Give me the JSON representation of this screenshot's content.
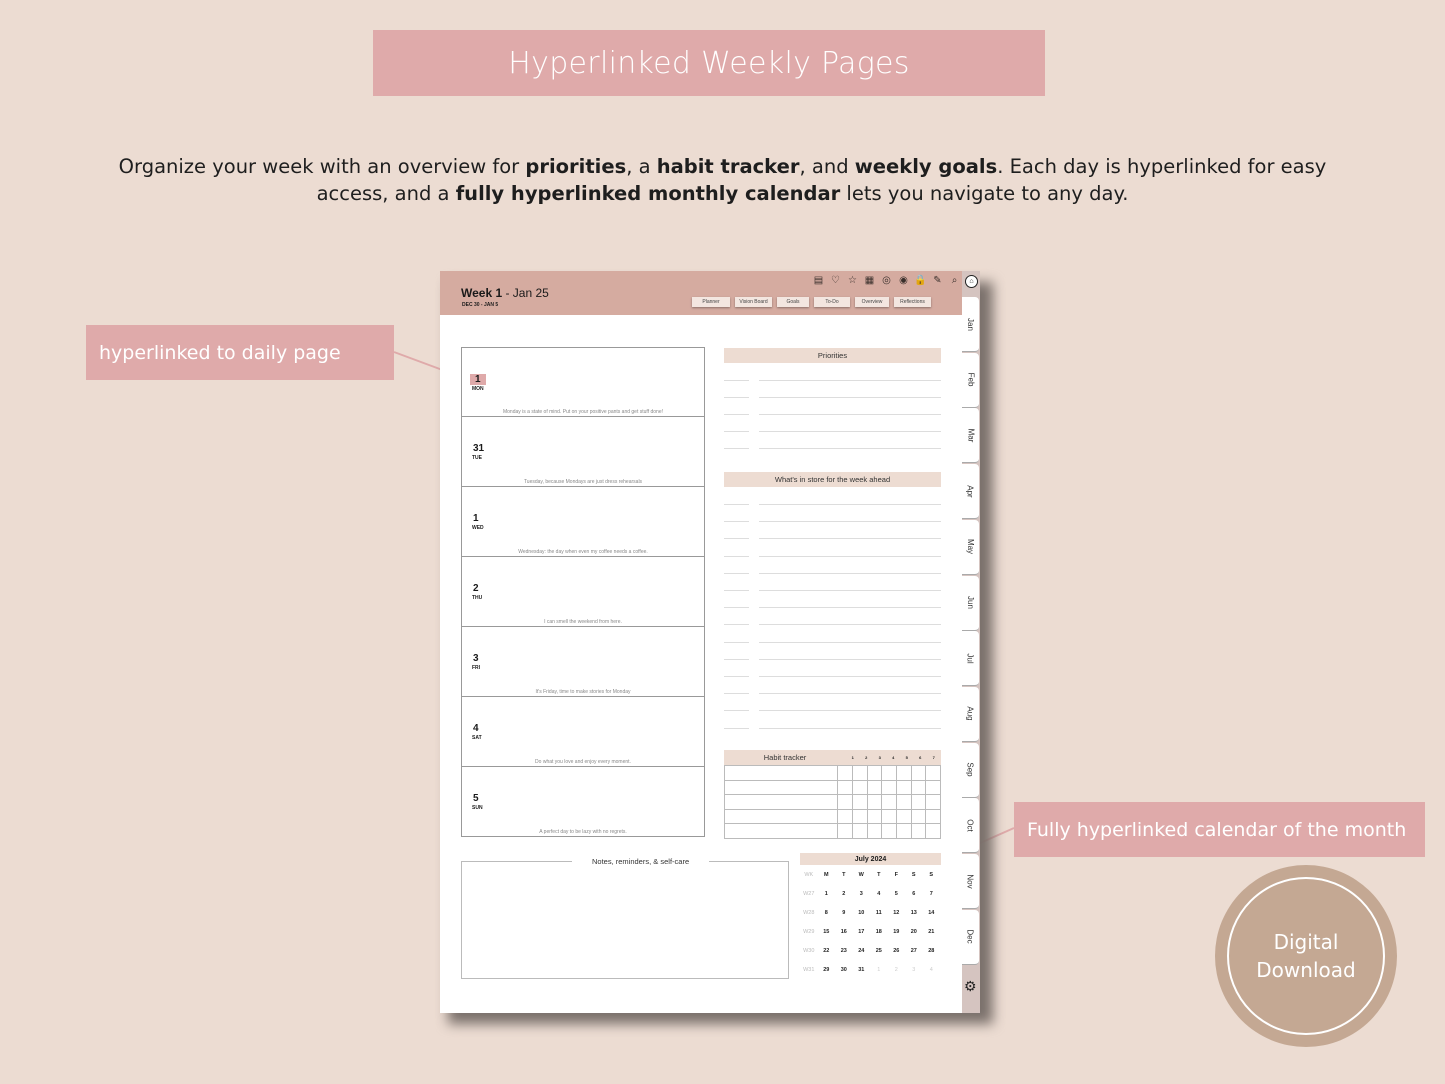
{
  "banner": {
    "title": "Hyperlinked Weekly Pages"
  },
  "description": {
    "parts": [
      {
        "text": "Organize your week with an overview for ",
        "bold": false
      },
      {
        "text": "priorities",
        "bold": true
      },
      {
        "text": ", a ",
        "bold": false
      },
      {
        "text": "habit tracker",
        "bold": true
      },
      {
        "text": ", and ",
        "bold": false
      },
      {
        "text": "weekly goals",
        "bold": true
      },
      {
        "text": ". Each day is hyperlinked for easy access, and a ",
        "bold": false
      },
      {
        "text": "fully hyperlinked monthly calendar",
        "bold": true
      },
      {
        "text": " lets you navigate to any day.",
        "bold": false
      }
    ]
  },
  "callouts": {
    "left": "hyperlinked to daily page",
    "right": "Fully hyperlinked calendar of the month"
  },
  "badge": {
    "line1": "Digital",
    "line2": "Download"
  },
  "colors": {
    "accent": "#dfaaaa",
    "header": "#d5aba0",
    "background": "#ecdcd2",
    "badge": "#c4a893",
    "section": "#eddcd2"
  },
  "planner": {
    "week_label": "Week 1",
    "week_suffix": " - Jan 25",
    "date_range": "DEC 30 - JAN 5",
    "icons": [
      "clipboard-icon",
      "heart-icon",
      "star-icon",
      "calendar-icon",
      "bullseye-icon",
      "target-icon",
      "lock-icon",
      "notepad-icon",
      "search-icon"
    ],
    "icon_glyphs": [
      "▤",
      "♡",
      "☆",
      "▦",
      "◎",
      "◉",
      "🔒",
      "✎",
      "⌕"
    ],
    "nav_buttons": [
      "Planner",
      "Vision Board",
      "Goals",
      "To-Do",
      "Overview",
      "Reflections"
    ],
    "months": [
      "Jan",
      "Feb",
      "Mar",
      "Apr",
      "May",
      "Jun",
      "Jul",
      "Aug",
      "Sep",
      "Oct",
      "Nov",
      "Dec"
    ],
    "days": [
      {
        "num": "1",
        "name": "MON",
        "quote": "Monday is a state of mind. Put on your positive pants and get stuff done!",
        "highlight": true
      },
      {
        "num": "31",
        "name": "TUE",
        "quote": "Tuesday, because Mondays are just dress rehearsals",
        "highlight": false
      },
      {
        "num": "1",
        "name": "WED",
        "quote": "Wednesday: the day when even my coffee needs a coffee.",
        "highlight": false
      },
      {
        "num": "2",
        "name": "THU",
        "quote": "I can smell the weekend from here.",
        "highlight": false
      },
      {
        "num": "3",
        "name": "FRI",
        "quote": "It's Friday, time to make stories for Monday",
        "highlight": false
      },
      {
        "num": "4",
        "name": "SAT",
        "quote": "Do what you love and enjoy every moment.",
        "highlight": false
      },
      {
        "num": "5",
        "name": "SUN",
        "quote": "A perfect day to be lazy with no regrets.",
        "highlight": false
      }
    ],
    "priorities_title": "Priorities",
    "priorities_lines": 5,
    "week_ahead_title": "What's in store for the week ahead",
    "week_ahead_lines": 14,
    "habit_tracker": {
      "title": "Habit tracker",
      "columns": [
        "1",
        "2",
        "3",
        "4",
        "5",
        "6",
        "7"
      ],
      "rows": 5
    },
    "notes_title": "Notes, reminders, & self-care",
    "calendar": {
      "title": "July 2024",
      "headers": [
        "WK",
        "M",
        "T",
        "W",
        "T",
        "F",
        "S",
        "S"
      ],
      "weeks": [
        {
          "wk": "W27",
          "days": [
            "1",
            "2",
            "3",
            "4",
            "5",
            "6",
            "7"
          ],
          "dim": []
        },
        {
          "wk": "W28",
          "days": [
            "8",
            "9",
            "10",
            "11",
            "12",
            "13",
            "14"
          ],
          "dim": []
        },
        {
          "wk": "W29",
          "days": [
            "15",
            "16",
            "17",
            "18",
            "19",
            "20",
            "21"
          ],
          "dim": []
        },
        {
          "wk": "W30",
          "days": [
            "22",
            "23",
            "24",
            "25",
            "26",
            "27",
            "28"
          ],
          "dim": []
        },
        {
          "wk": "W31",
          "days": [
            "29",
            "30",
            "31",
            "1",
            "2",
            "3",
            "4"
          ],
          "dim": [
            3,
            4,
            5,
            6
          ]
        }
      ]
    }
  }
}
